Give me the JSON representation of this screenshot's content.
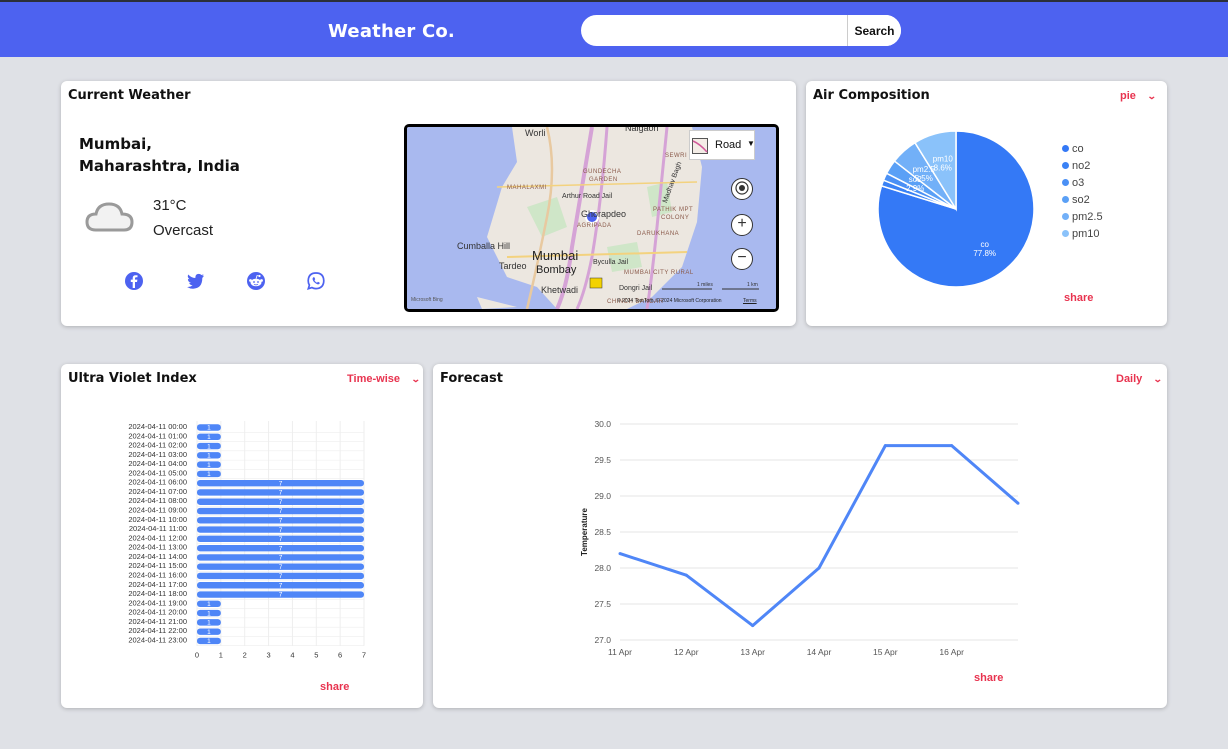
{
  "header": {
    "brand": "Weather Co.",
    "search_placeholder": "",
    "search_value": "",
    "search_button": "Search",
    "bar_color": "#4d62f0"
  },
  "current_weather": {
    "title": "Current Weather",
    "city_line1": "Mumbai,",
    "city_line2": "Maharashtra, India",
    "temperature": "31°C",
    "condition": "Overcast",
    "condition_icon": "cloud-icon",
    "social": [
      "facebook-icon",
      "twitter-icon",
      "reddit-icon",
      "whatsapp-icon"
    ],
    "map": {
      "style_label": "Road",
      "labels": {
        "worli": "Worli",
        "naigaon": "Naigaon",
        "sewri": "SEWRI",
        "gundecha": "GUNDECHA",
        "garden": "GARDEN",
        "mahalaxmi": "MAHALAXMI",
        "arthur": "Arthur Road Jail",
        "madhav": "Madhav Bagh",
        "ghorapdeo": "Ghorapdeo",
        "pathik": "PATHIK MPT",
        "colony": "COLONY",
        "agripada": "AGRIPADA",
        "darukhana": "DARUKHANA",
        "cumballa": "Cumballa Hill",
        "mumbai": "Mumbai",
        "bombay": "Bombay",
        "tardeo": "Tardeo",
        "byculla": "Byculla Jail",
        "mumbaicity": "MUMBAI CITY RURAL",
        "khetwadi": "Khetwadi",
        "dongri": "Dongri Jail",
        "chinch": "CHINCH BANDAR",
        "attribution": "© 2024 TomTom, © 2024 Microsoft Corporation",
        "terms": "Terms",
        "bing": "Microsoft Bing",
        "scale_miles": "1 miles",
        "scale_km": "1 km"
      }
    }
  },
  "air": {
    "title": "Air Composition",
    "dropdown": "pie",
    "share": "share",
    "chart_data": {
      "type": "pie",
      "categories": [
        "co",
        "no2",
        "o3",
        "so2",
        "pm2.5",
        "pm10"
      ],
      "values": [
        77.8,
        1.2,
        1.5,
        2.9,
        5.5,
        8.6
      ],
      "slice_labels": [
        {
          "name": "co",
          "pct": "77.8%"
        },
        {
          "name": "so2",
          "pct": "2.9%"
        },
        {
          "name": "pm2.5",
          "pct": "5.5%"
        },
        {
          "name": "pm10",
          "pct": "8.6%"
        }
      ],
      "legend_position": "right",
      "colors": [
        "#3479f6",
        "#3a82f5",
        "#4a90f5",
        "#5aa0f6",
        "#72b0f8",
        "#8ac2fa"
      ]
    }
  },
  "uv": {
    "title": "Ultra Violet Index",
    "dropdown": "Time-wise",
    "share": "share",
    "chart_data": {
      "type": "bar",
      "orientation": "horizontal",
      "categories": [
        "2024-04-11 00:00",
        "2024-04-11 01:00",
        "2024-04-11 02:00",
        "2024-04-11 03:00",
        "2024-04-11 04:00",
        "2024-04-11 05:00",
        "2024-04-11 06:00",
        "2024-04-11 07:00",
        "2024-04-11 08:00",
        "2024-04-11 09:00",
        "2024-04-11 10:00",
        "2024-04-11 11:00",
        "2024-04-11 12:00",
        "2024-04-11 13:00",
        "2024-04-11 14:00",
        "2024-04-11 15:00",
        "2024-04-11 16:00",
        "2024-04-11 17:00",
        "2024-04-11 18:00",
        "2024-04-11 19:00",
        "2024-04-11 20:00",
        "2024-04-11 21:00",
        "2024-04-11 22:00",
        "2024-04-11 23:00"
      ],
      "values": [
        1,
        1,
        1,
        1,
        1,
        1,
        7,
        7,
        7,
        7,
        7,
        7,
        7,
        7,
        7,
        7,
        7,
        7,
        7,
        1,
        1,
        1,
        1,
        1
      ],
      "xlim": [
        0,
        7
      ],
      "xticks": [
        "0",
        "1",
        "2",
        "3",
        "4",
        "5",
        "6",
        "7"
      ],
      "bar_color": "#4f86f7"
    }
  },
  "forecast": {
    "title": "Forecast",
    "dropdown": "Daily",
    "share": "share",
    "chart_data": {
      "type": "line",
      "x": [
        "11 Apr",
        "12 Apr",
        "13 Apr",
        "14 Apr",
        "15 Apr",
        "16 Apr",
        ""
      ],
      "xticks": [
        "11 Apr",
        "12 Apr",
        "13 Apr",
        "14 Apr",
        "15 Apr",
        "16 Apr"
      ],
      "values": [
        28.2,
        27.9,
        27.2,
        28.0,
        29.7,
        29.7,
        28.9
      ],
      "ylabel": "Temperature",
      "ylim": [
        27.0,
        30.0
      ],
      "yticks": [
        "27.0",
        "27.5",
        "28.0",
        "28.5",
        "29.0",
        "29.5",
        "30.0"
      ],
      "grid": true,
      "line_color": "#4f86f7"
    }
  }
}
